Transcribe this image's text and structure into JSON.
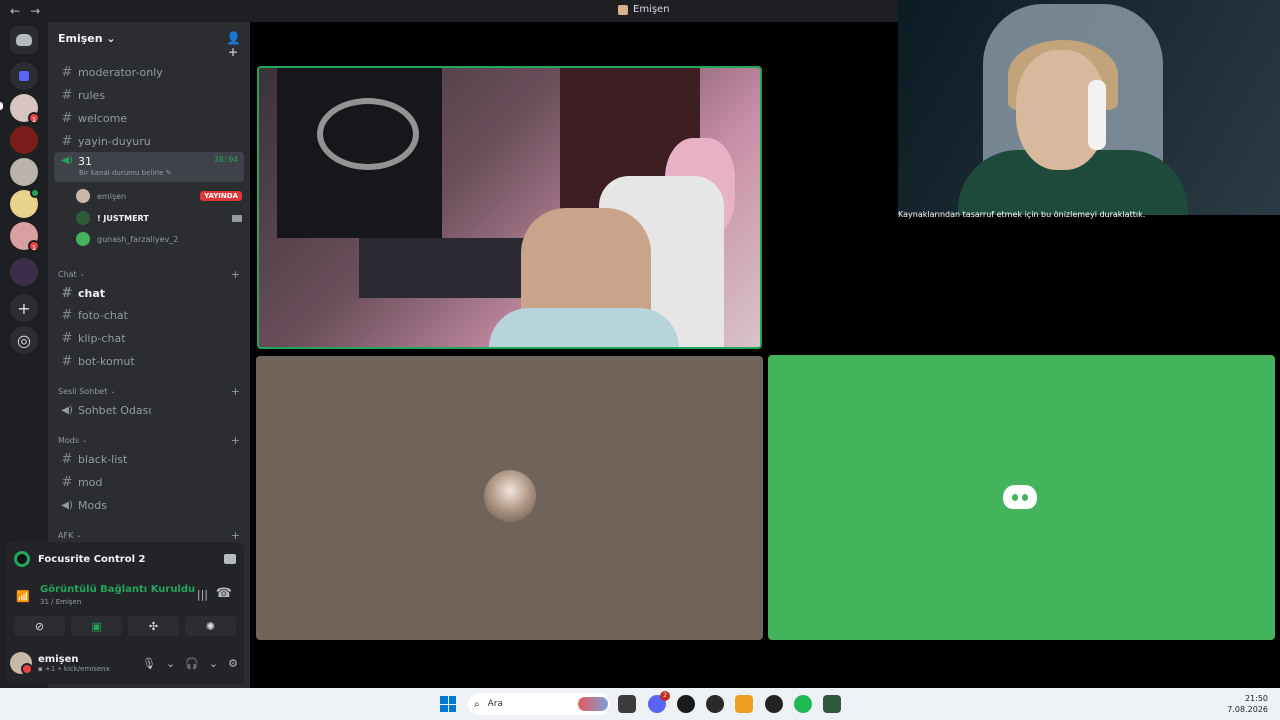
{
  "titlebar": {
    "back": "←",
    "forward": "→",
    "title": "Emişen"
  },
  "servers": {
    "add_label": "+",
    "explore_label": "◎",
    "badges": [
      "1",
      "1"
    ]
  },
  "guild": {
    "name": "Emişen ⌄",
    "add_member_icon": "👤+"
  },
  "channels": {
    "top": [
      {
        "name": "moderator-only",
        "type": "text"
      },
      {
        "name": "rules",
        "type": "text"
      },
      {
        "name": "welcome",
        "type": "text"
      },
      {
        "name": "yayin-duyuru",
        "type": "text"
      }
    ],
    "voice_active": {
      "name": "31",
      "timer": "38:04",
      "status": "Bir kanal durumu belirle ✎",
      "members": [
        {
          "name": "emişen",
          "badge": "YAYINDA"
        },
        {
          "name": "! JUSTMERT",
          "badge": ""
        },
        {
          "name": "gunash_farzaliyev_2",
          "badge": ""
        }
      ]
    },
    "chat_category": "Chat",
    "chat_channels": [
      "chat",
      "foto-chat",
      "klip-chat",
      "bot-komut"
    ],
    "voice_category": "Sesli Sohbet",
    "voice_channels": [
      "Sohbet Odası"
    ],
    "mods_category": "Mods",
    "mods_channels": [
      {
        "name": "black-list",
        "type": "text"
      },
      {
        "name": "mod",
        "type": "text"
      },
      {
        "name": "Mods",
        "type": "voice"
      }
    ],
    "afk_category": "AFK"
  },
  "panel": {
    "app_name": "Focusrite Control 2",
    "connection_status": "Görüntülü Bağlantı Kuruldu",
    "connection_sub": "31 / Emişen",
    "user": {
      "name": "emişen",
      "status": "kick/emisenx",
      "status_prefix": "▪ +1 •"
    }
  },
  "overlay": {
    "caption": "Kaynaklarından tasarruf etmek için bu önizlemeyi duraklattık."
  },
  "taskbar": {
    "search_placeholder": "Ara",
    "discord_badge": "2",
    "time": "21:50",
    "date": "7.08.2026"
  },
  "colors": {
    "green": "#23a55a",
    "red": "#da373c",
    "blurple": "#5865f2",
    "tile_green": "#43b45c"
  }
}
